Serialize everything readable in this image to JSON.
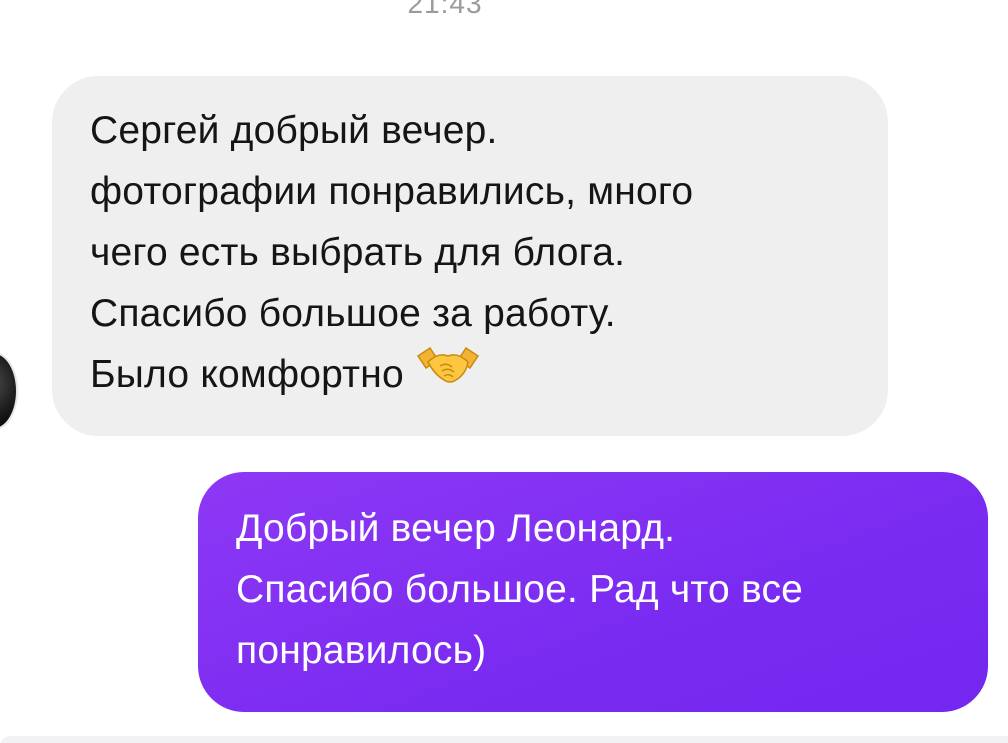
{
  "conversation": {
    "timestamp": "21:43",
    "messages": [
      {
        "direction": "incoming",
        "lines": [
          "Сергей добрый вечер.",
          "фотографии понравились, много",
          "чего есть выбрать для блога.",
          "Спасибо большое за работу.",
          "Было комфортно"
        ],
        "emoji": "handshake-emoji"
      },
      {
        "direction": "outgoing",
        "lines": [
          "Добрый вечер Леонард.",
          "Спасибо большое. Рад что все",
          "понравилось)"
        ]
      }
    ]
  },
  "colors": {
    "incoming_bubble": "#efeff0",
    "outgoing_bubble": "#7b2cf1",
    "timestamp": "#9a9a9f"
  }
}
